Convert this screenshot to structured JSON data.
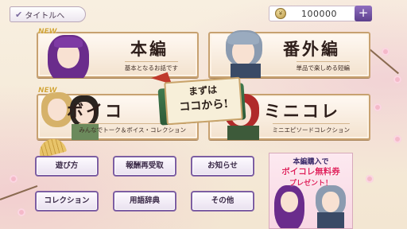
{
  "topbar": {
    "title_button": "タイトルへ",
    "coin_value": "100000",
    "plus": "+"
  },
  "cards": {
    "honpen": {
      "title": "本編",
      "subtitle": "基本となるお話です",
      "badge": "NEW"
    },
    "bangaihen": {
      "title": "番外編",
      "subtitle": "単品で楽しめる短編"
    },
    "voicolle": {
      "title": "ボイコ",
      "subtitle": "みんなでトーク＆ボイス・コレクション",
      "badge": "NEW"
    },
    "minicolle": {
      "title": "ミニコレ",
      "subtitle": "ミニエピソードコレクション"
    }
  },
  "banner": {
    "line1": "まずは",
    "line2": "ココから!"
  },
  "buttons": {
    "asobikata": "遊び方",
    "houshu": "報酬再受取",
    "oshirase": "お知らせ",
    "collection": "コレクション",
    "yougo": "用語辞典",
    "sonota": "その他"
  },
  "promo": {
    "line1": "本編購入で",
    "line2": "ボイコレ無料券",
    "line3": "プレゼント！"
  },
  "colors": {
    "card_border": "#c7a170",
    "button_border": "#7d5ea3",
    "promo_accent": "#e0245e"
  }
}
